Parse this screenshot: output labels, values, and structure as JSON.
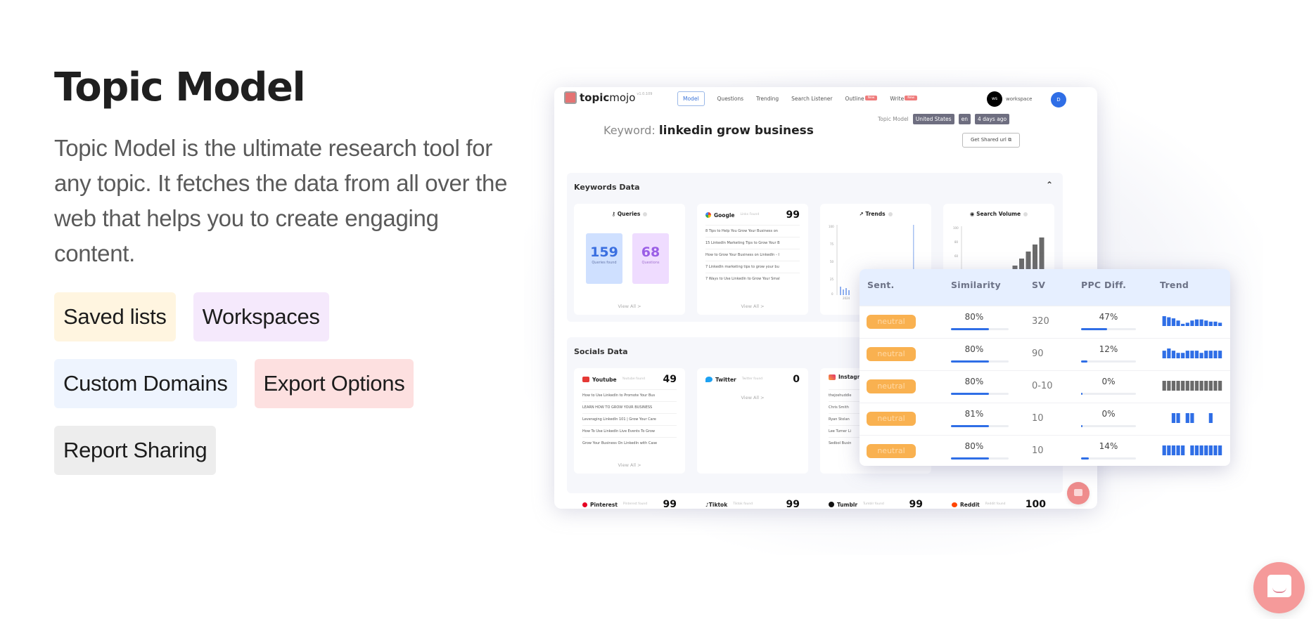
{
  "hero": {
    "title": "Topic Model",
    "description": "Topic Model is the ultimate research tool for any topic. It fetches the data from all over the web that helps you to create engaging content.",
    "features": [
      "Saved lists",
      "Workspaces",
      "Custom Domains",
      "Export Options",
      "Report Sharing"
    ]
  },
  "app": {
    "logo": {
      "bold": "topic",
      "light": "mojo",
      "version": "v1.0.109"
    },
    "nav": [
      {
        "label": "Model",
        "active": true
      },
      {
        "label": "Questions"
      },
      {
        "label": "Trending"
      },
      {
        "label": "Search Listener"
      },
      {
        "label": "Outline",
        "badge": "New"
      },
      {
        "label": "Write",
        "badge": "New"
      }
    ],
    "workspace": {
      "avatar": "ws",
      "label": "workspace"
    },
    "user_avatar": "D",
    "keyword_label": "Keyword:",
    "keyword": "linkedin grow business",
    "meta": {
      "label": "Topic Model",
      "country": "United States",
      "lang": "en",
      "age": "4 days ago"
    },
    "share_button": "Get Shared url",
    "keywords_section": {
      "title": "Keywords Data",
      "queries": {
        "title": "Queries",
        "queries_found": 159,
        "queries_found_label": "Queries found",
        "questions": 68,
        "questions_label": "Questions",
        "view_all": "View All >"
      },
      "google": {
        "title": "Google",
        "sub": "Links Found",
        "count": 99,
        "items": [
          "8 Tips to Help You Grow Your Business on",
          "15 LinkedIn Marketing Tips to Grow Your B",
          "How to Grow Your Business on LinkedIn - I",
          "7 LinkedIn marketing tips to grow your bu",
          "7 Ways to Use LinkedIn to Grow Your Smal"
        ],
        "view_all": "View All >"
      },
      "trends": {
        "title": "Trends",
        "y_ticks": [
          "100",
          "75",
          "50",
          "25",
          "0"
        ],
        "x_tick": "2024"
      },
      "search_volume": {
        "title": "Search Volume",
        "y_ticks": [
          "100",
          "80",
          "60"
        ]
      }
    },
    "socials_section": {
      "title": "Socials Data",
      "youtube": {
        "title": "Youtube",
        "sub": "Youtube found",
        "count": 49,
        "items": [
          "How to Use LinkedIn to Promote Your Bus",
          "LEARN HOW TO GROW YOUR BUSINESS",
          "Leveraging LinkedIn 101 | Grow Your Care",
          "How To Use LinkedIn Live Events To Grow",
          "Grow Your Business On LinkedIn with Case"
        ],
        "view_all": "View All >"
      },
      "twitter": {
        "title": "Twitter",
        "sub": "Twitter found",
        "count": 0,
        "view_all": "View All >"
      },
      "instagram": {
        "title": "Instagram",
        "items": [
          "thejoshuddle",
          "Chris Smith",
          "Ryan Stolan",
          "Lee Turner Li",
          "Sedbol Busin"
        ]
      },
      "row3": [
        {
          "title": "Pinterest",
          "sub": "Pinterest found",
          "count": 99
        },
        {
          "title": "Tiktok",
          "sub": "Tiktok found",
          "count": 99
        },
        {
          "title": "Tumblr",
          "sub": "Tumblr found",
          "count": 99
        },
        {
          "title": "Reddit",
          "sub": "Reddit found",
          "count": 100
        }
      ]
    }
  },
  "table": {
    "headers": [
      "Sent.",
      "Similarity",
      "SV",
      "PPC Diff.",
      "Trend"
    ],
    "rows": [
      {
        "sentiment": "neutral",
        "similarity": "80%",
        "similarity_value": 80,
        "sv": "320",
        "ppc": "47%",
        "ppc_value": 47,
        "trend": [
          9,
          8,
          7,
          5,
          2,
          3,
          5,
          6,
          6,
          5,
          4,
          4,
          3
        ],
        "trend_color": "#2f6ee6"
      },
      {
        "sentiment": "neutral",
        "similarity": "80%",
        "similarity_value": 80,
        "sv": "90",
        "ppc": "12%",
        "ppc_value": 12,
        "trend": [
          7,
          9,
          7,
          5,
          5,
          7,
          7,
          7,
          5,
          7,
          7,
          7,
          7
        ],
        "trend_color": "#2f6ee6"
      },
      {
        "sentiment": "neutral",
        "similarity": "80%",
        "similarity_value": 80,
        "sv": "0-10",
        "ppc": "0%",
        "ppc_value": 0,
        "trend": [
          9,
          9,
          9,
          9,
          9,
          9,
          9,
          9,
          9,
          9,
          9,
          9,
          9
        ],
        "trend_color": "#6a6a6a"
      },
      {
        "sentiment": "neutral",
        "similarity": "81%",
        "similarity_value": 81,
        "sv": "10",
        "ppc": "0%",
        "ppc_value": 0,
        "trend": [
          0,
          0,
          9,
          9,
          0,
          9,
          9,
          0,
          0,
          0,
          9,
          0,
          0
        ],
        "trend_color": "#2f6ee6"
      },
      {
        "sentiment": "neutral",
        "similarity": "80%",
        "similarity_value": 80,
        "sv": "10",
        "ppc": "14%",
        "ppc_value": 14,
        "trend": [
          9,
          9,
          9,
          9,
          9,
          0,
          9,
          9,
          9,
          9,
          9,
          9,
          9
        ],
        "trend_color": "#2f6ee6"
      }
    ]
  },
  "colors": {
    "accent": "#2f6ee6",
    "neutral_pill": "#f9b150",
    "chat": "#f59a9a"
  }
}
